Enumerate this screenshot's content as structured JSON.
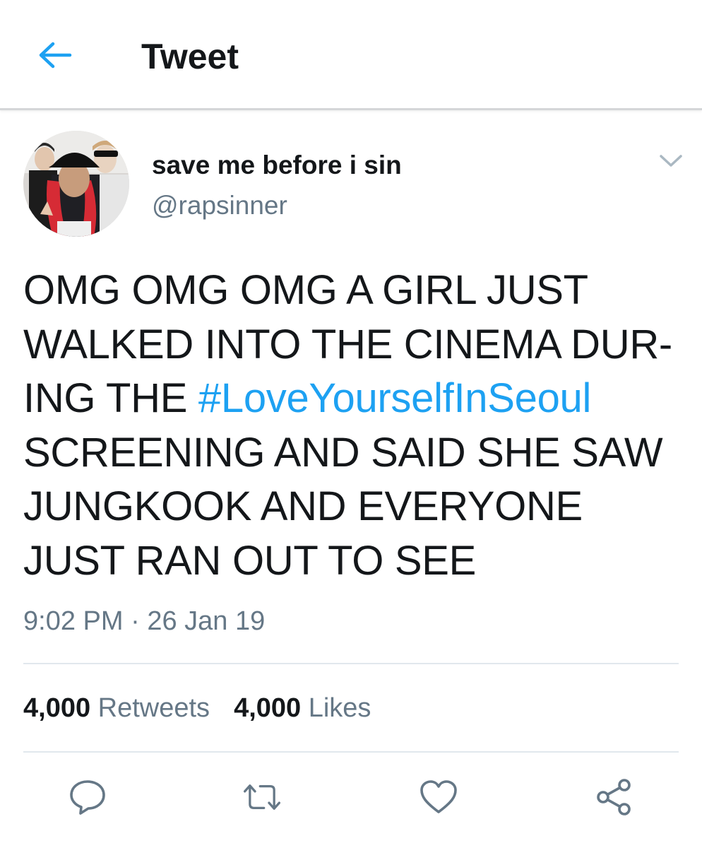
{
  "header": {
    "title": "Tweet",
    "back_icon": "arrow-left-icon",
    "accent_color": "#1da1f2"
  },
  "author": {
    "display_name": "save me before i sin",
    "handle": "@rapsinner",
    "avatar": "avatar-photo",
    "menu_icon": "chevron-down-icon"
  },
  "tweet": {
    "lines": [
      "OMG OMG OMG A GIRL JUST",
      "WALKED INTO THE CINEMA DUR-",
      "ING THE ",
      "SCREENING AND SAID SHE SAW",
      "JUNGKOOK AND EVERYONE",
      "JUST RAN OUT TO SEE"
    ],
    "hashtag": "#LoveYourselfInSeoul",
    "time": "9:02 PM",
    "separator": "·",
    "date": "26 Jan 19"
  },
  "stats": {
    "retweets_count": "4,000",
    "retweets_label": "Retweets",
    "likes_count": "4,000",
    "likes_label": "Likes"
  },
  "actions": {
    "reply_icon": "reply-icon",
    "retweet_icon": "retweet-icon",
    "like_icon": "heart-icon",
    "share_icon": "share-icon",
    "icon_color": "#657786"
  }
}
